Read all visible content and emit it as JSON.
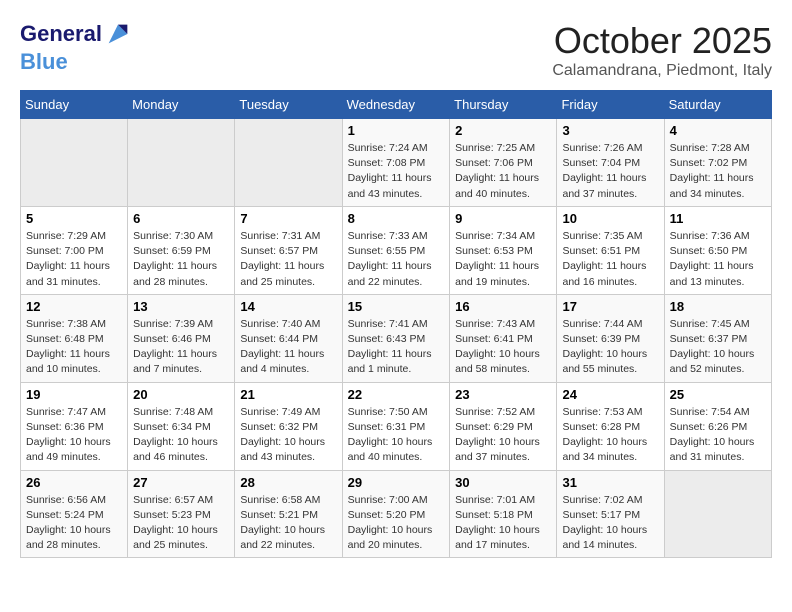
{
  "header": {
    "logo_line1": "General",
    "logo_line2": "Blue",
    "month": "October 2025",
    "location": "Calamandrana, Piedmont, Italy"
  },
  "weekdays": [
    "Sunday",
    "Monday",
    "Tuesday",
    "Wednesday",
    "Thursday",
    "Friday",
    "Saturday"
  ],
  "weeks": [
    [
      {
        "day": "",
        "info": ""
      },
      {
        "day": "",
        "info": ""
      },
      {
        "day": "",
        "info": ""
      },
      {
        "day": "1",
        "info": "Sunrise: 7:24 AM\nSunset: 7:08 PM\nDaylight: 11 hours and 43 minutes."
      },
      {
        "day": "2",
        "info": "Sunrise: 7:25 AM\nSunset: 7:06 PM\nDaylight: 11 hours and 40 minutes."
      },
      {
        "day": "3",
        "info": "Sunrise: 7:26 AM\nSunset: 7:04 PM\nDaylight: 11 hours and 37 minutes."
      },
      {
        "day": "4",
        "info": "Sunrise: 7:28 AM\nSunset: 7:02 PM\nDaylight: 11 hours and 34 minutes."
      }
    ],
    [
      {
        "day": "5",
        "info": "Sunrise: 7:29 AM\nSunset: 7:00 PM\nDaylight: 11 hours and 31 minutes."
      },
      {
        "day": "6",
        "info": "Sunrise: 7:30 AM\nSunset: 6:59 PM\nDaylight: 11 hours and 28 minutes."
      },
      {
        "day": "7",
        "info": "Sunrise: 7:31 AM\nSunset: 6:57 PM\nDaylight: 11 hours and 25 minutes."
      },
      {
        "day": "8",
        "info": "Sunrise: 7:33 AM\nSunset: 6:55 PM\nDaylight: 11 hours and 22 minutes."
      },
      {
        "day": "9",
        "info": "Sunrise: 7:34 AM\nSunset: 6:53 PM\nDaylight: 11 hours and 19 minutes."
      },
      {
        "day": "10",
        "info": "Sunrise: 7:35 AM\nSunset: 6:51 PM\nDaylight: 11 hours and 16 minutes."
      },
      {
        "day": "11",
        "info": "Sunrise: 7:36 AM\nSunset: 6:50 PM\nDaylight: 11 hours and 13 minutes."
      }
    ],
    [
      {
        "day": "12",
        "info": "Sunrise: 7:38 AM\nSunset: 6:48 PM\nDaylight: 11 hours and 10 minutes."
      },
      {
        "day": "13",
        "info": "Sunrise: 7:39 AM\nSunset: 6:46 PM\nDaylight: 11 hours and 7 minutes."
      },
      {
        "day": "14",
        "info": "Sunrise: 7:40 AM\nSunset: 6:44 PM\nDaylight: 11 hours and 4 minutes."
      },
      {
        "day": "15",
        "info": "Sunrise: 7:41 AM\nSunset: 6:43 PM\nDaylight: 11 hours and 1 minute."
      },
      {
        "day": "16",
        "info": "Sunrise: 7:43 AM\nSunset: 6:41 PM\nDaylight: 10 hours and 58 minutes."
      },
      {
        "day": "17",
        "info": "Sunrise: 7:44 AM\nSunset: 6:39 PM\nDaylight: 10 hours and 55 minutes."
      },
      {
        "day": "18",
        "info": "Sunrise: 7:45 AM\nSunset: 6:37 PM\nDaylight: 10 hours and 52 minutes."
      }
    ],
    [
      {
        "day": "19",
        "info": "Sunrise: 7:47 AM\nSunset: 6:36 PM\nDaylight: 10 hours and 49 minutes."
      },
      {
        "day": "20",
        "info": "Sunrise: 7:48 AM\nSunset: 6:34 PM\nDaylight: 10 hours and 46 minutes."
      },
      {
        "day": "21",
        "info": "Sunrise: 7:49 AM\nSunset: 6:32 PM\nDaylight: 10 hours and 43 minutes."
      },
      {
        "day": "22",
        "info": "Sunrise: 7:50 AM\nSunset: 6:31 PM\nDaylight: 10 hours and 40 minutes."
      },
      {
        "day": "23",
        "info": "Sunrise: 7:52 AM\nSunset: 6:29 PM\nDaylight: 10 hours and 37 minutes."
      },
      {
        "day": "24",
        "info": "Sunrise: 7:53 AM\nSunset: 6:28 PM\nDaylight: 10 hours and 34 minutes."
      },
      {
        "day": "25",
        "info": "Sunrise: 7:54 AM\nSunset: 6:26 PM\nDaylight: 10 hours and 31 minutes."
      }
    ],
    [
      {
        "day": "26",
        "info": "Sunrise: 6:56 AM\nSunset: 5:24 PM\nDaylight: 10 hours and 28 minutes."
      },
      {
        "day": "27",
        "info": "Sunrise: 6:57 AM\nSunset: 5:23 PM\nDaylight: 10 hours and 25 minutes."
      },
      {
        "day": "28",
        "info": "Sunrise: 6:58 AM\nSunset: 5:21 PM\nDaylight: 10 hours and 22 minutes."
      },
      {
        "day": "29",
        "info": "Sunrise: 7:00 AM\nSunset: 5:20 PM\nDaylight: 10 hours and 20 minutes."
      },
      {
        "day": "30",
        "info": "Sunrise: 7:01 AM\nSunset: 5:18 PM\nDaylight: 10 hours and 17 minutes."
      },
      {
        "day": "31",
        "info": "Sunrise: 7:02 AM\nSunset: 5:17 PM\nDaylight: 10 hours and 14 minutes."
      },
      {
        "day": "",
        "info": ""
      }
    ]
  ]
}
